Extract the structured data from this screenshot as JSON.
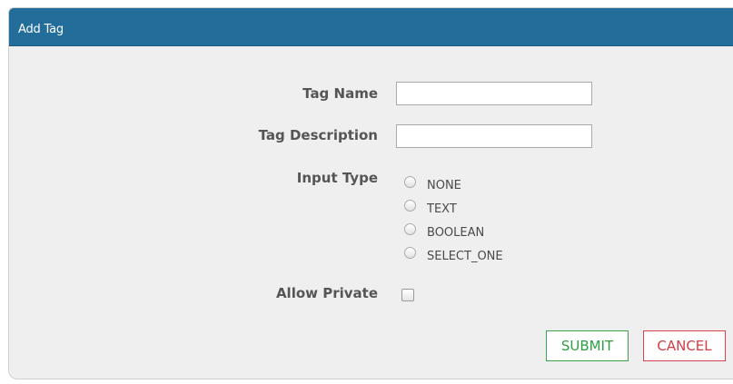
{
  "dialog": {
    "title": "Add Tag"
  },
  "form": {
    "tag_name": {
      "label": "Tag Name",
      "value": ""
    },
    "tag_description": {
      "label": "Tag Description",
      "value": ""
    },
    "input_type": {
      "label": "Input Type",
      "options": [
        "NONE",
        "TEXT",
        "BOOLEAN",
        "SELECT_ONE"
      ],
      "selected": null
    },
    "allow_private": {
      "label": "Allow Private",
      "checked": false
    }
  },
  "actions": {
    "submit_label": "SUBMIT",
    "cancel_label": "CANCEL"
  },
  "colors": {
    "header": "#236d9a",
    "submit": "#2f9e44",
    "cancel": "#d23c45",
    "background": "#efefef"
  }
}
